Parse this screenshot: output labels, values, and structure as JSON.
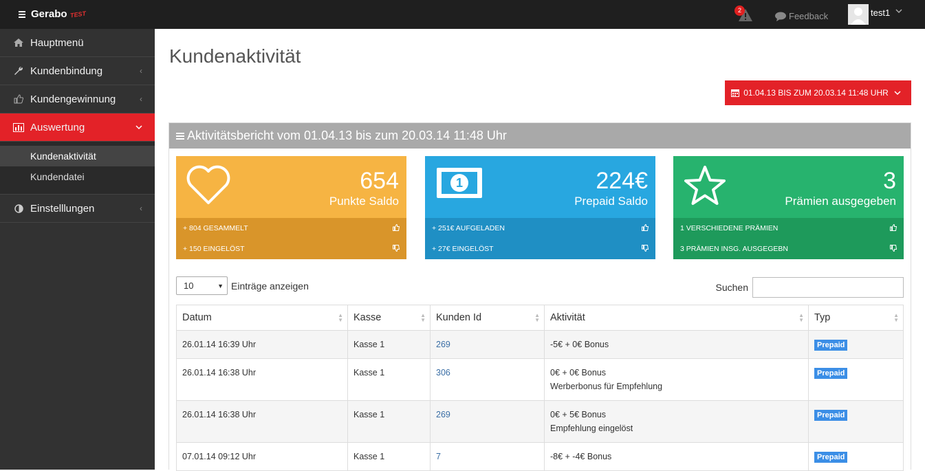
{
  "topbar": {
    "logo_text": "Gerabo",
    "logo_badge": "TEST",
    "alert_count": "2",
    "feedback_label": "Feedback",
    "username": "test1"
  },
  "sidebar": {
    "items": [
      {
        "label": "Hauptmenü",
        "icon": "home-icon"
      },
      {
        "label": "Kundenbindung",
        "icon": "wrench-icon"
      },
      {
        "label": "Kundengewinnung",
        "icon": "thumbs-up-icon"
      },
      {
        "label": "Auswertung",
        "icon": "bar-chart-icon"
      },
      {
        "label": "Einstelllungen",
        "icon": "contrast-icon"
      }
    ],
    "subitems": [
      {
        "label": "Kundenaktivität"
      },
      {
        "label": "Kundendatei"
      }
    ]
  },
  "main": {
    "title": "Kundenaktivität",
    "date_range_button": "01.04.13 BIS ZUM 20.03.14 11:48 UHR",
    "panel_title": "Aktivitätsbericht vom 01.04.13 bis zum 20.03.14 11:48 Uhr",
    "stats": [
      {
        "value": "654",
        "label": "Punkte Saldo",
        "line1": "+ 804 GESAMMELT",
        "line2": "+ 150 EINGELÖST",
        "color": "#f6b443",
        "footer_color": "#d9952a",
        "icon": "heart-icon"
      },
      {
        "value": "224€",
        "label": "Prepaid Saldo",
        "line1": "+ 251€ AUFGELADEN",
        "line2": "+ 27€ EINGELÖST",
        "color": "#28a7e0",
        "footer_color": "#1f8fc4",
        "icon": "money-icon"
      },
      {
        "value": "3",
        "label": "Prämien ausgegeben",
        "line1": "1 VERSCHIEDENE PRÄMIEN",
        "line2": "3 PRÄMIEN INSG. AUSGEGEBN",
        "color": "#27b36e",
        "footer_color": "#1e9a5b",
        "icon": "star-icon"
      }
    ],
    "entries_select_value": "10",
    "entries_label": "Einträge anzeigen",
    "search_label": "Suchen",
    "table": {
      "headers": [
        "Datum",
        "Kasse",
        "Kunden Id",
        "Aktivität",
        "Typ"
      ],
      "rows": [
        {
          "datum": "26.01.14 16:39 Uhr",
          "kasse": "Kasse 1",
          "kunden_id": "269",
          "aktivitaet": "-5€ + 0€ Bonus",
          "aktivitaet2": "",
          "typ": "Prepaid"
        },
        {
          "datum": "26.01.14 16:38 Uhr",
          "kasse": "Kasse 1",
          "kunden_id": "306",
          "aktivitaet": "0€ + 0€ Bonus",
          "aktivitaet2": "Werberbonus für Empfehlung",
          "typ": "Prepaid"
        },
        {
          "datum": "26.01.14 16:38 Uhr",
          "kasse": "Kasse 1",
          "kunden_id": "269",
          "aktivitaet": "0€ + 5€ Bonus",
          "aktivitaet2": "Empfehlung eingelöst",
          "typ": "Prepaid"
        },
        {
          "datum": "07.01.14 09:12 Uhr",
          "kasse": "Kasse 1",
          "kunden_id": "7",
          "aktivitaet": "-8€ + -4€ Bonus",
          "aktivitaet2": "",
          "typ": "Prepaid"
        }
      ]
    }
  }
}
